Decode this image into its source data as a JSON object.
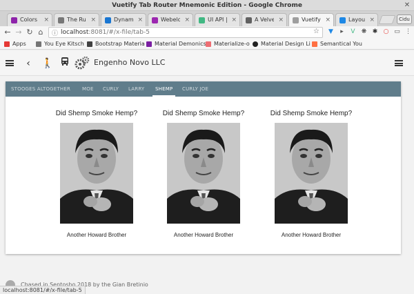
{
  "window": {
    "title": "Vuetify Tab Router Mnemonic Edition - Google Chrome"
  },
  "tabs": [
    {
      "title": "Colors - M",
      "favicon_color": "#8e24aa",
      "active": false
    },
    {
      "title": "The Rule",
      "favicon_color": "#777777",
      "active": false
    },
    {
      "title": "Dynamic",
      "favicon_color": "#1976d2",
      "active": false
    },
    {
      "title": "Webelos",
      "favicon_color": "#9c27b0",
      "active": false
    },
    {
      "title": "UI API | V",
      "favicon_color": "#41b883",
      "active": false
    },
    {
      "title": "A Velvet",
      "favicon_color": "#616161",
      "active": false
    },
    {
      "title": "Vuetify Ta",
      "favicon_color": "#9e9e9e",
      "active": true
    },
    {
      "title": "Layout p",
      "favicon_color": "#1e88e5",
      "active": false
    }
  ],
  "profile_label": "Cidu",
  "toolbar": {
    "url_host": "localhost",
    "url_path": ":8081/#/x-file/tab-5"
  },
  "bookmarks": [
    {
      "label": "Apps",
      "color": "#e53935"
    },
    {
      "label": "You Eye Kitsch",
      "color": "#757575"
    },
    {
      "label": "Bootstrap Materia",
      "color": "#424242"
    },
    {
      "label": "Material Demonics",
      "color": "#7b1fa2"
    },
    {
      "label": "Materialize-o",
      "color": "#ee6e73"
    },
    {
      "label": "Material Design Li",
      "color": "#212121"
    },
    {
      "label": "Semantical You",
      "color": "#ff7043"
    }
  ],
  "appbar": {
    "title": "Engenho Novo LLC"
  },
  "stooge_tabs": [
    {
      "label": "Stooges Altogether",
      "active": false
    },
    {
      "label": "Moe",
      "active": false
    },
    {
      "label": "Curly",
      "active": false
    },
    {
      "label": "Larry",
      "active": false
    },
    {
      "label": "Shemp",
      "active": true
    },
    {
      "label": "Curly Joe",
      "active": false
    }
  ],
  "cards": [
    {
      "question": "Did Shemp Smoke Hemp?",
      "caption": "Another Howard Brother"
    },
    {
      "question": "Did Shemp Smoke Hemp?",
      "caption": "Another Howard Brother"
    },
    {
      "question": "Did Shemp Smoke Hemp?",
      "caption": "Another Howard Brother"
    }
  ],
  "footer": {
    "text": "Chased in Sentosho 2018 by the Gian Bretinio"
  },
  "status": {
    "url": "localhost:8081/#/x-file/tab-5"
  },
  "colors": {
    "tabs_bar": "#607d8b"
  }
}
